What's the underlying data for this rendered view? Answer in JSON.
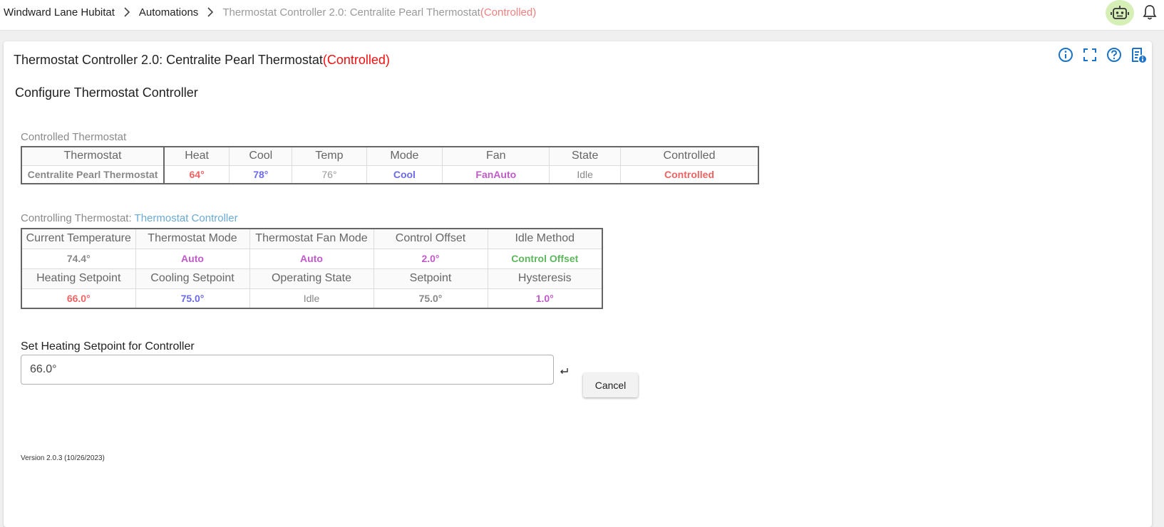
{
  "breadcrumbs": {
    "home": "Windward Lane Hubitat",
    "automations": "Automations",
    "current": "Thermostat Controller 2.0: Centralite Pearl Thermostat",
    "current_suffix": "(Controlled)"
  },
  "icons": {
    "bot": "robot-icon",
    "bell": "bell-icon",
    "info": "info-icon",
    "fullscreen": "fullscreen-icon",
    "help": "help-icon",
    "log": "log-info-icon",
    "enter": "enter-icon",
    "chevron": "chevron-right-icon"
  },
  "colors": {
    "accent": "#1a73c8",
    "heat": "#f06262",
    "cool": "#6b6be8",
    "purple": "#c05ac8",
    "green": "#5cb85c",
    "controlled": "#ee1111"
  },
  "card": {
    "title": "Thermostat Controller 2.0: Centralite Pearl Thermostat",
    "title_suffix": "(Controlled)",
    "subtitle": "Configure Thermostat Controller"
  },
  "controlled": {
    "label": "Controlled Thermostat",
    "headers": [
      "Thermostat",
      "Heat",
      "Cool",
      "Temp",
      "Mode",
      "Fan",
      "State",
      "Controlled"
    ],
    "values": [
      "Centralite Pearl Thermostat",
      "64°",
      "78°",
      "76°",
      "Cool",
      "FanAuto",
      "Idle",
      "Controlled"
    ]
  },
  "controlling": {
    "label": "Controlling Thermostat: ",
    "link": "Thermostat Controller",
    "headers1": [
      "Current Temperature",
      "Thermostat Mode",
      "Thermostat Fan Mode",
      "Control Offset",
      "Idle Method"
    ],
    "values1": [
      "74.4°",
      "Auto",
      "Auto",
      "2.0°",
      "Control Offset"
    ],
    "headers2": [
      "Heating Setpoint",
      "Cooling Setpoint",
      "Operating State",
      "Setpoint",
      "Hysteresis"
    ],
    "values2": [
      "66.0°",
      "75.0°",
      "Idle",
      "75.0°",
      "1.0°"
    ]
  },
  "setpoint": {
    "label": "Set Heating Setpoint for Controller",
    "value": "66.0°",
    "cancel": "Cancel"
  },
  "version": "Version 2.0.3 (10/26/2023)"
}
